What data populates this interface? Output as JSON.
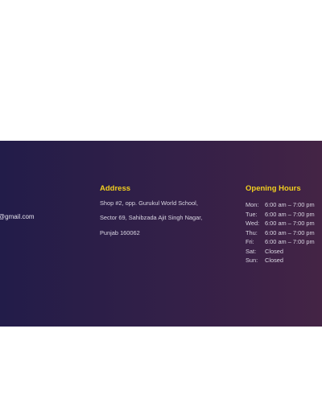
{
  "contact": {
    "email_partial": "@gmail.com"
  },
  "address": {
    "heading": "Address",
    "lines": [
      "Shop #2, opp. Gurukul World School,",
      "Sector 69, Sahibzada Ajit Singh Nagar,",
      "Punjab 160062"
    ]
  },
  "opening_hours": {
    "heading": "Opening Hours",
    "rows": [
      {
        "day": "Mon:",
        "time": "6:00 am – 7:00 pm"
      },
      {
        "day": "Tue:",
        "time": "6:00 am – 7:00 pm"
      },
      {
        "day": "Wed:",
        "time": "6:00 am – 7:00 pm"
      },
      {
        "day": "Thu:",
        "time": "6:00 am – 7:00 pm"
      },
      {
        "day": "Fri:",
        "time": "6:00 am – 7:00 pm"
      },
      {
        "day": "Sat:",
        "time": "Closed"
      },
      {
        "day": "Sun:",
        "time": "Closed"
      }
    ]
  },
  "colors": {
    "heading_accent": "#f2cf1f",
    "band_start": "#221c49",
    "band_end": "#442445"
  }
}
